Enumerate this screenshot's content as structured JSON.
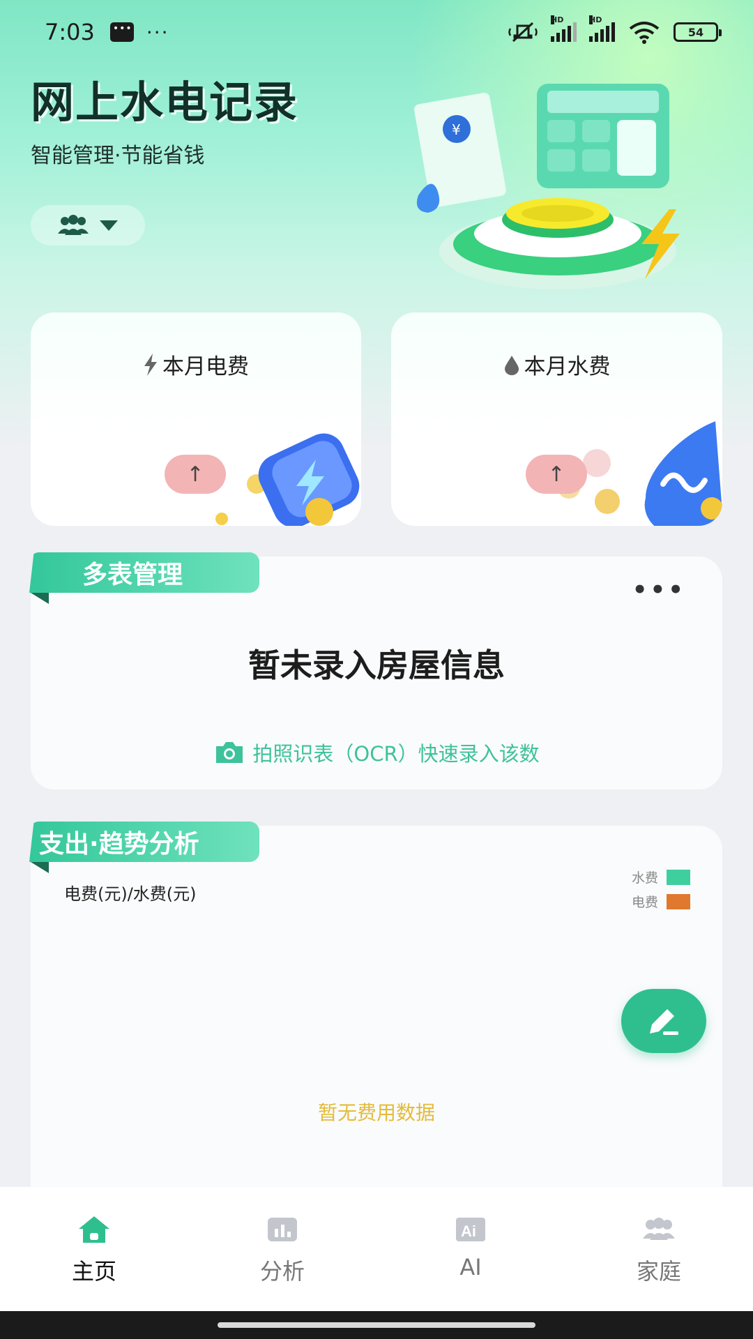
{
  "status_bar": {
    "time": "7:03",
    "hd1": "HD",
    "hd2": "HD",
    "battery": "54"
  },
  "header": {
    "title": "网上水电记录",
    "subtitle": "智能管理·节能省钱"
  },
  "fee_cards": {
    "electricity": {
      "title": "本月电费",
      "trend": "↑"
    },
    "water": {
      "title": "本月水费",
      "trend": "↑"
    }
  },
  "meter_section": {
    "title": "多表管理",
    "more": "•••",
    "empty_text": "暂未录入房屋信息",
    "ocr_link": "拍照识表（OCR）快速录入该数"
  },
  "trend_section": {
    "title": "支出·趋势分析",
    "axis_label": "电费(元)/水费(元)",
    "legend": [
      {
        "label": "水费",
        "color": "#3fcf9e"
      },
      {
        "label": "电费",
        "color": "#e0782e"
      }
    ],
    "no_data": "暂无费用数据"
  },
  "tabs": [
    {
      "label": "主页",
      "icon": "home-icon",
      "active": true
    },
    {
      "label": "分析",
      "icon": "chart-icon",
      "active": false
    },
    {
      "label": "AI",
      "icon": "ai-icon",
      "active": false
    },
    {
      "label": "家庭",
      "icon": "family-icon",
      "active": false
    }
  ],
  "colors": {
    "accent": "#2fbf8f",
    "no_data": "#e3bb3a",
    "trend_badge": "#f3b4b6"
  }
}
